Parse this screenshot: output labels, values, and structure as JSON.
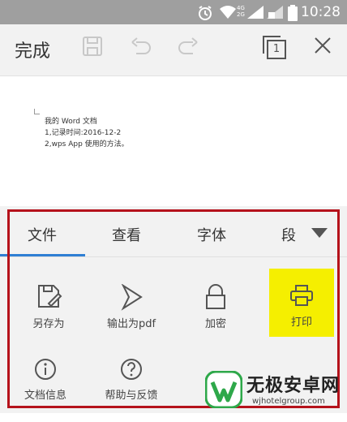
{
  "status_bar": {
    "time": "10:28",
    "network": "4G 2G",
    "icons": [
      "alarm-icon",
      "wifi-icon",
      "signal-icon",
      "signal-icon",
      "battery-icon"
    ]
  },
  "toolbar": {
    "done_label": "完成",
    "page_count": "1",
    "icons": [
      "save-icon",
      "undo-icon",
      "redo-icon",
      "page-count-icon",
      "close-icon"
    ]
  },
  "document": {
    "lines": [
      "我的 Word 文档",
      "1,记录时间:2016-12-2",
      "2,wps App 使用的方法。"
    ]
  },
  "bottom_panel": {
    "tabs": [
      "文件",
      "查看",
      "字体",
      "段"
    ],
    "active_tab": "文件",
    "items": [
      {
        "label": "另存为",
        "icon": "save-as-icon"
      },
      {
        "label": "输出为pdf",
        "icon": "export-pdf-icon"
      },
      {
        "label": "加密",
        "icon": "lock-icon"
      },
      {
        "label": "打印",
        "icon": "printer-icon"
      },
      {
        "label": "文档信息",
        "icon": "info-icon"
      },
      {
        "label": "帮助与反馈",
        "icon": "help-icon"
      }
    ],
    "highlight_color": "#f5ef00",
    "tab_underline_color": "#2f7fd4",
    "annotation_box_color": "#b5121b"
  },
  "watermark": {
    "title": "无极安卓网",
    "url": "wjhotelgroup.com",
    "brand_color": "#2ea84a"
  }
}
